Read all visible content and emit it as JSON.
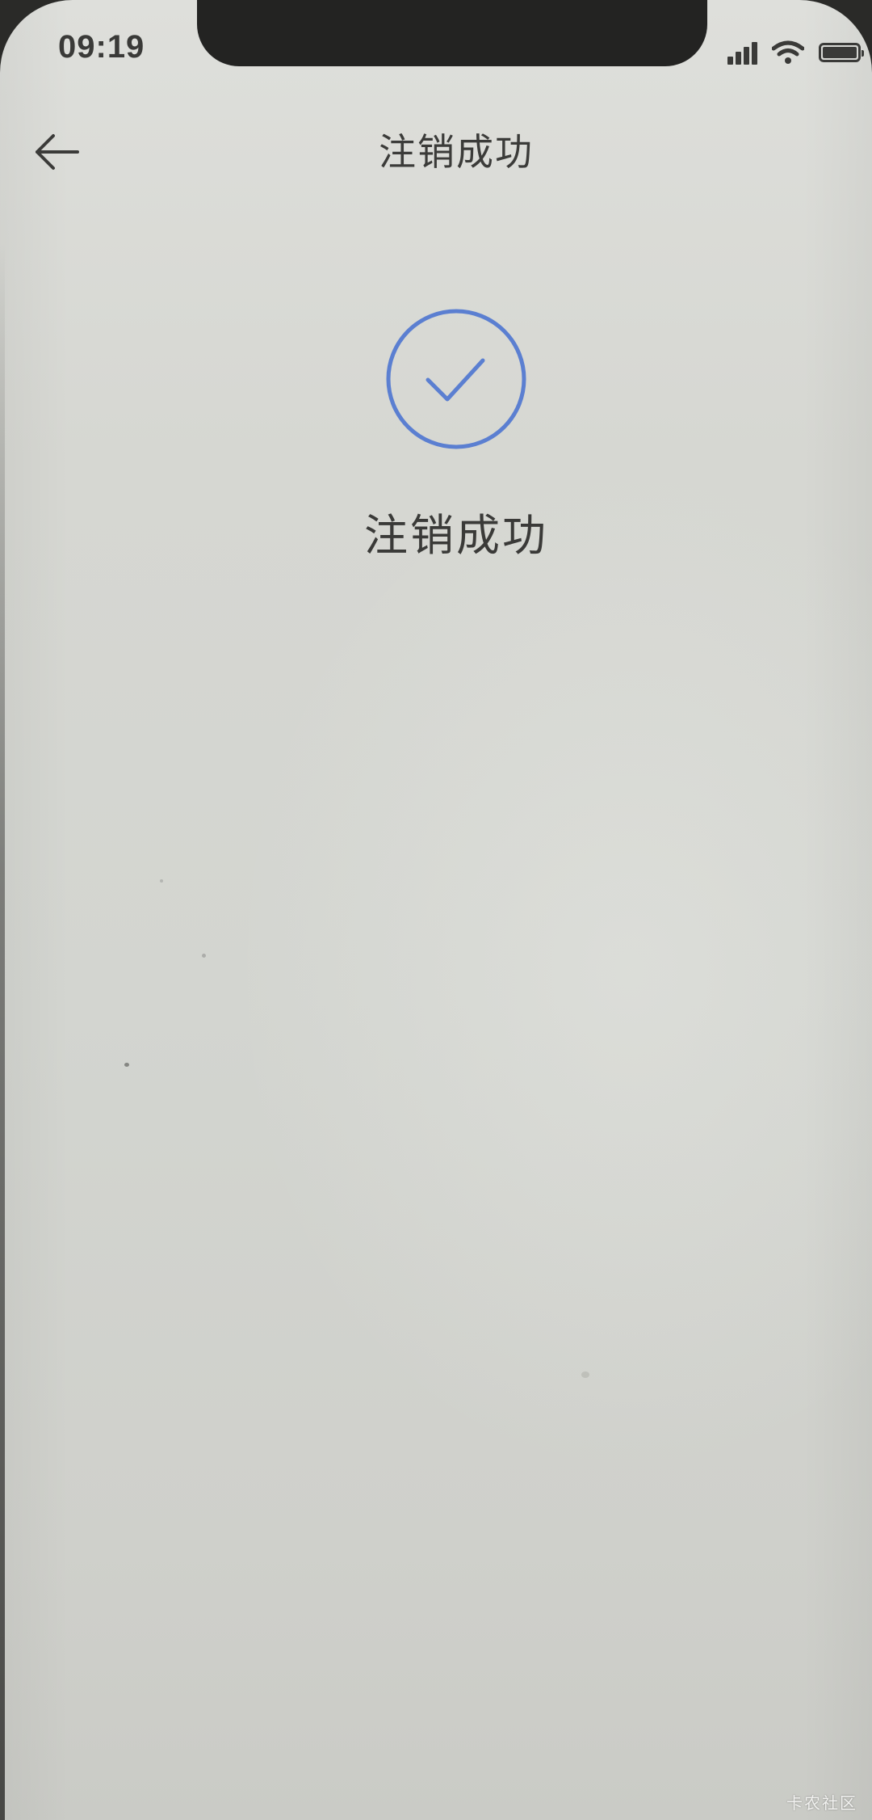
{
  "status_bar": {
    "time": "09:19",
    "icons": [
      "signal-icon",
      "wifi-icon",
      "battery-icon"
    ],
    "battery_level": 1.0
  },
  "nav_bar": {
    "back_icon": "arrow-left-icon",
    "title": "注销成功"
  },
  "result": {
    "icon": "check-circle-icon",
    "accent_color": "#5b7fd1",
    "message": "注销成功"
  },
  "watermark": {
    "text": "卡农社区"
  }
}
